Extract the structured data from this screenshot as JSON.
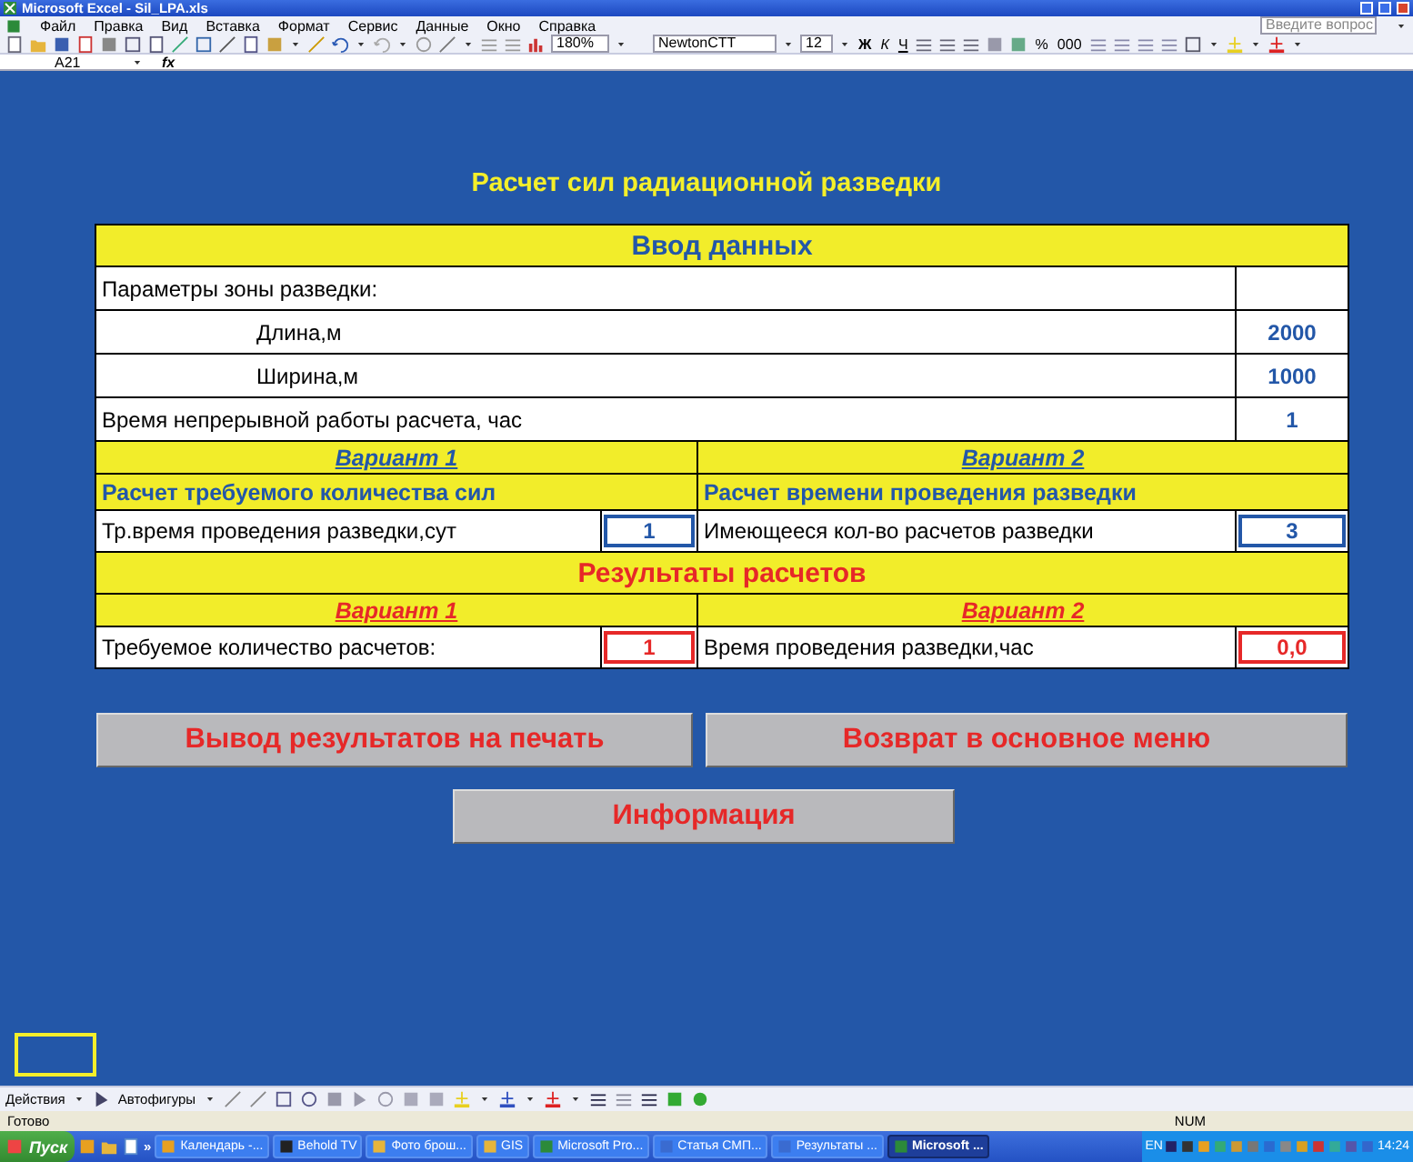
{
  "window": {
    "title": "Microsoft Excel - Sil_LPA.xls"
  },
  "menu": [
    "Файл",
    "Правка",
    "Вид",
    "Вставка",
    "Формат",
    "Сервис",
    "Данные",
    "Окно",
    "Справка"
  ],
  "help": {
    "placeholder": "Введите вопрос"
  },
  "toolbar": {
    "zoom": "180%",
    "font": "NewtonCTT",
    "size": "12",
    "bold": "Ж",
    "italic": "К",
    "underline": "Ч",
    "percent": "%",
    "thousands": "000"
  },
  "formula_bar": {
    "name_box": "A21",
    "function_label": "fx"
  },
  "sheet": {
    "title": "Расчет сил радиационной разведки",
    "input_heading": "Ввод данных",
    "rows": [
      {
        "kind": "group",
        "label": "Параметры зоны разведки:"
      },
      {
        "kind": "sub",
        "label": "Длина,м",
        "value": "2000"
      },
      {
        "kind": "sub",
        "label": "Ширина,м",
        "value": "1000"
      },
      {
        "kind": "param",
        "label": "Время непрерывной работы расчета, час",
        "value": "1"
      }
    ],
    "input_variants": [
      {
        "heading": "Вариант 1",
        "title": "Расчет требуемого количества сил",
        "label": "Тр.время проведения разведки,сут",
        "value": "1"
      },
      {
        "heading": "Вариант 2",
        "title": "Расчет времени проведения разведки",
        "label": "Имеющееся кол-во расчетов разведки",
        "value": "3"
      }
    ],
    "results_heading": "Результаты расчетов",
    "result_variants": [
      {
        "heading": "Вариант 1",
        "label": "Требуемое количество расчетов:",
        "value": "1"
      },
      {
        "heading": "Вариант 2",
        "label": "Время проведения разведки,час",
        "value": "0,0"
      }
    ],
    "buttons": [
      "Вывод результатов на печать",
      "Возврат в основное меню",
      "Информация"
    ]
  },
  "drawing_toolbar": {
    "actions": "Действия",
    "autoshapes": "Автофигуры"
  },
  "status_bar": {
    "status": "Готово",
    "num": "NUM"
  },
  "taskbar": {
    "start": "Пуск",
    "chevron": "»",
    "tasks": [
      {
        "label": "Календарь -...",
        "selected": false
      },
      {
        "label": "Behold TV",
        "selected": false
      },
      {
        "label": "Фото брош...",
        "selected": false
      },
      {
        "label": "GIS",
        "selected": false
      },
      {
        "label": "Microsoft Pro...",
        "selected": false
      },
      {
        "label": "Статья СМП...",
        "selected": false
      },
      {
        "label": "Результаты ...",
        "selected": false
      },
      {
        "label": "Microsoft ...",
        "selected": true
      }
    ],
    "language": "EN",
    "clock": "14:24"
  }
}
